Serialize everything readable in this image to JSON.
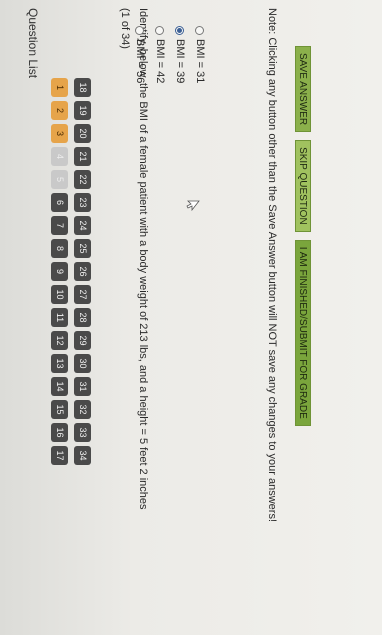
{
  "header": {
    "title": "Question List"
  },
  "question_list": {
    "row1": [
      {
        "label": "1",
        "state": "answered"
      },
      {
        "label": "2",
        "state": "answered"
      },
      {
        "label": "3",
        "state": "answered"
      },
      {
        "label": "4",
        "state": "dim"
      },
      {
        "label": "5",
        "state": "dim"
      },
      {
        "label": "6",
        "state": "normal"
      },
      {
        "label": "7",
        "state": "normal"
      },
      {
        "label": "8",
        "state": "normal"
      },
      {
        "label": "9",
        "state": "normal"
      },
      {
        "label": "10",
        "state": "normal"
      },
      {
        "label": "11",
        "state": "normal"
      },
      {
        "label": "12",
        "state": "normal"
      },
      {
        "label": "13",
        "state": "normal"
      },
      {
        "label": "14",
        "state": "normal"
      },
      {
        "label": "15",
        "state": "normal"
      },
      {
        "label": "16",
        "state": "normal"
      },
      {
        "label": "17",
        "state": "normal"
      }
    ],
    "row2": [
      {
        "label": "18",
        "state": "normal"
      },
      {
        "label": "19",
        "state": "normal"
      },
      {
        "label": "20",
        "state": "normal"
      },
      {
        "label": "21",
        "state": "normal"
      },
      {
        "label": "22",
        "state": "normal"
      },
      {
        "label": "23",
        "state": "normal"
      },
      {
        "label": "24",
        "state": "normal"
      },
      {
        "label": "25",
        "state": "normal"
      },
      {
        "label": "26",
        "state": "normal"
      },
      {
        "label": "27",
        "state": "normal"
      },
      {
        "label": "28",
        "state": "normal"
      },
      {
        "label": "29",
        "state": "normal"
      },
      {
        "label": "30",
        "state": "normal"
      },
      {
        "label": "31",
        "state": "normal"
      },
      {
        "label": "32",
        "state": "normal"
      },
      {
        "label": "33",
        "state": "normal"
      },
      {
        "label": "34",
        "state": "normal"
      }
    ]
  },
  "question": {
    "counter": "(1 of 34)",
    "text": "Identify, below, the BMI of a female patient with a body weight of 213 lbs, and a height = 5 feet 2 inches",
    "options": [
      {
        "label": "BMI = 31",
        "checked": false
      },
      {
        "label": "BMI = 39",
        "checked": true
      },
      {
        "label": "BMI = 42",
        "checked": false
      },
      {
        "label": "BMI = 56",
        "checked": false
      }
    ]
  },
  "note": "Note: Clicking any button other than the Save Answer button will NOT save any changes to your answers!",
  "actions": {
    "save": "SAVE ANSWER",
    "skip": "SKIP QUESTION",
    "finish": "I AM FINISHED/SUBMIT FOR GRADE"
  },
  "colors": {
    "answered": "#e6a44a",
    "unanswered": "#4a4a4a",
    "action_green": "#8bb04b",
    "radio_selected": "#3b5f95"
  }
}
